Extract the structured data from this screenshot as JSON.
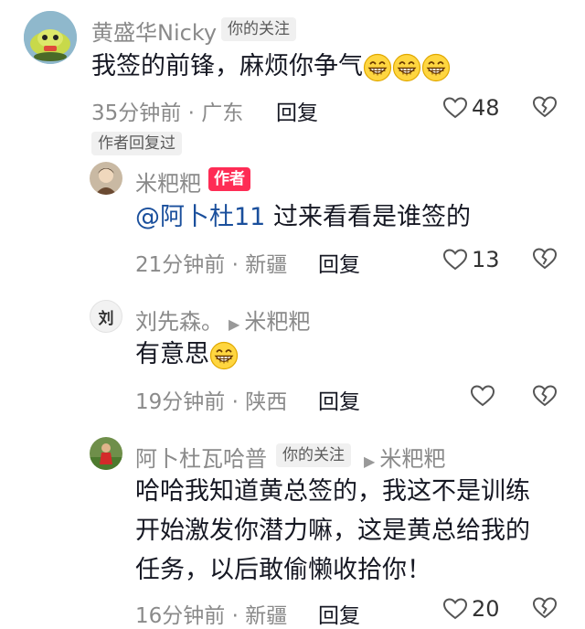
{
  "comments": [
    {
      "username": "黄盛华Nicky",
      "tag": "你的关注",
      "text": "我签的前锋，麻烦你争气",
      "emoji": "grinning-emoji",
      "time": "35分钟前",
      "location": "广东",
      "reply_label": "回复",
      "likes": "48",
      "author_replied": "作者回复过"
    },
    {
      "username": "米粑粑",
      "tag": "作者",
      "mention": "@阿卜杜11",
      "text": "过来看看是谁签的",
      "time": "21分钟前",
      "location": "新疆",
      "reply_label": "回复",
      "likes": "13"
    },
    {
      "username": "刘先森。",
      "reply_to": "米粑粑",
      "avatar_text": "刘",
      "text": "有意思",
      "emoji": "grinning-emoji",
      "time": "19分钟前",
      "location": "陕西",
      "reply_label": "回复"
    },
    {
      "username": "阿卜杜瓦哈普",
      "tag": "你的关注",
      "reply_to": "米粑粑",
      "lines": [
        "哈哈我知道黄总签的，我这不是训练",
        "开始激发你潜力嘛，这是黄总给我的",
        "任务，以后敢偷懒收拾你！"
      ],
      "time": "16分钟前",
      "location": "新疆",
      "reply_label": "回复",
      "likes": "20"
    }
  ],
  "separator": " · ",
  "colors": {
    "author_badge": "#fe2c55",
    "muted_text": "#8a8a8a",
    "mention": "#1a4f9c"
  }
}
